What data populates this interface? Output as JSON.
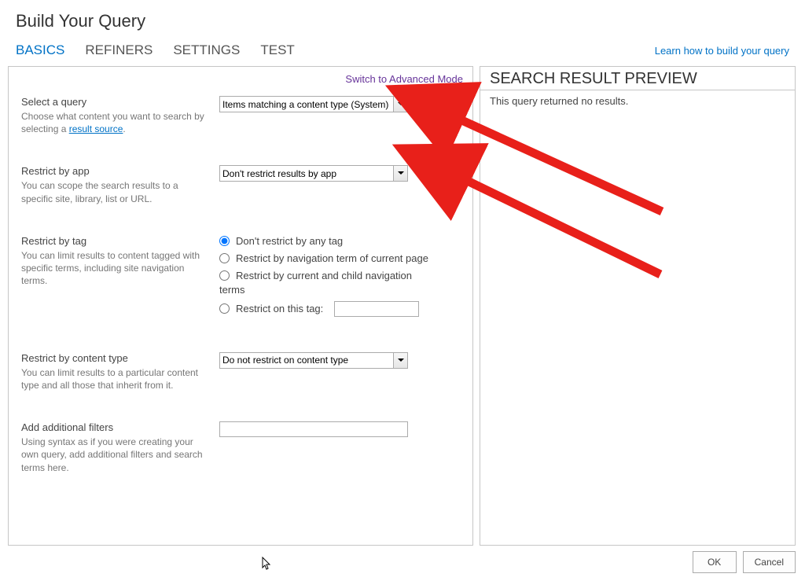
{
  "title": "Build Your Query",
  "tabs": [
    "BASICS",
    "REFINERS",
    "SETTINGS",
    "TEST"
  ],
  "help_link": "Learn how to build your query",
  "mode_link": "Switch to Advanced Mode",
  "sections": {
    "select_query": {
      "title": "Select a query",
      "desc_pre": "Choose what content you want to search by selecting a ",
      "desc_link": "result source",
      "desc_post": ".",
      "value": "Items matching a content type (System)"
    },
    "restrict_app": {
      "title": "Restrict by app",
      "desc": "You can scope the search results to a specific site, library, list or URL.",
      "value": "Don't restrict results by app"
    },
    "restrict_tag": {
      "title": "Restrict by tag",
      "desc": "You can limit results to content tagged with specific terms, including site navigation terms.",
      "opt1": "Don't restrict by any tag",
      "opt2": "Restrict by navigation term of current page",
      "opt3": "Restrict by current and child navigation",
      "opt3b": "terms",
      "opt4": "Restrict on this tag:",
      "tag_value": ""
    },
    "restrict_ct": {
      "title": "Restrict by content type",
      "desc": "You can limit results to a particular content type and all those that inherit from it.",
      "value": "Do not restrict on content type"
    },
    "add_filters": {
      "title": "Add additional filters",
      "desc": "Using syntax as if you were creating your own query, add additional filters and search terms here.",
      "value": ""
    }
  },
  "preview": {
    "title": "SEARCH RESULT PREVIEW",
    "body": "This query returned no results."
  },
  "buttons": {
    "ok": "OK",
    "cancel": "Cancel"
  }
}
